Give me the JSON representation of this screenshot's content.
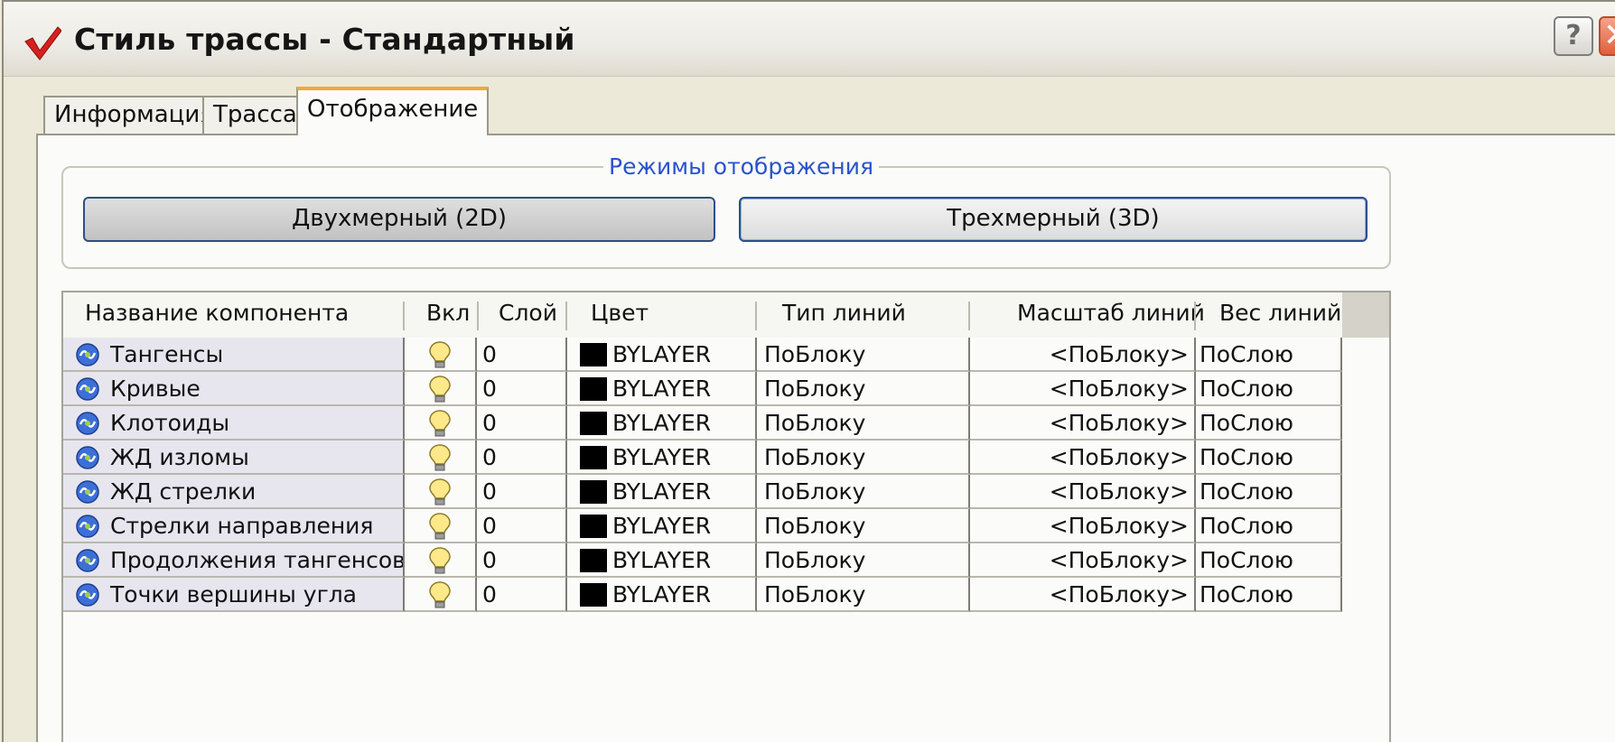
{
  "window": {
    "title": "Стиль трассы - Стандартный",
    "help_label": "?",
    "close_label": "✕"
  },
  "tabs": [
    {
      "label": "Информация",
      "active": false
    },
    {
      "label": "Трасса",
      "active": false
    },
    {
      "label": "Отображение",
      "active": true
    }
  ],
  "display_modes": {
    "legend": "Режимы отображения",
    "button_2d": "Двухмерный (2D)",
    "button_3d": "Трехмерный (3D)"
  },
  "table": {
    "columns": [
      "Название компонента",
      "Вкл",
      "Слой",
      "Цвет",
      "Тип линий",
      "Масштаб линий",
      "Вес линий"
    ],
    "rows": [
      {
        "name": "Тангенсы",
        "layer": "0",
        "color": "BYLAYER",
        "linetype": "ПоБлоку",
        "linescale": "<ПоБлоку>",
        "lineweight": "ПоСлою"
      },
      {
        "name": "Кривые",
        "layer": "0",
        "color": "BYLAYER",
        "linetype": "ПоБлоку",
        "linescale": "<ПоБлоку>",
        "lineweight": "ПоСлою"
      },
      {
        "name": "Клотоиды",
        "layer": "0",
        "color": "BYLAYER",
        "linetype": "ПоБлоку",
        "linescale": "<ПоБлоку>",
        "lineweight": "ПоСлою"
      },
      {
        "name": "ЖД изломы",
        "layer": "0",
        "color": "BYLAYER",
        "linetype": "ПоБлоку",
        "linescale": "<ПоБлоку>",
        "lineweight": "ПоСлою"
      },
      {
        "name": "ЖД стрелки",
        "layer": "0",
        "color": "BYLAYER",
        "linetype": "ПоБлоку",
        "linescale": "<ПоБлоку>",
        "lineweight": "ПоСлою"
      },
      {
        "name": "Стрелки направления",
        "layer": "0",
        "color": "BYLAYER",
        "linetype": "ПоБлоку",
        "linescale": "<ПоБлоку>",
        "lineweight": "ПоСлою"
      },
      {
        "name": "Продолжения тангенсов",
        "layer": "0",
        "color": "BYLAYER",
        "linetype": "ПоБлоку",
        "linescale": "<ПоБлоку>",
        "lineweight": "ПоСлою"
      },
      {
        "name": "Точки вершины угла",
        "layer": "0",
        "color": "BYLAYER",
        "linetype": "ПоБлоку",
        "linescale": "<ПоБлоку>",
        "lineweight": "ПоСлою"
      }
    ]
  },
  "colors": {
    "accent": "#2952cc",
    "active_tab_top": "#f1a93b",
    "bylayer_swatch": "#000000"
  },
  "icons": {
    "app": "red-check-icon",
    "row": "component-style-icon",
    "visibility": "lightbulb-icon"
  }
}
